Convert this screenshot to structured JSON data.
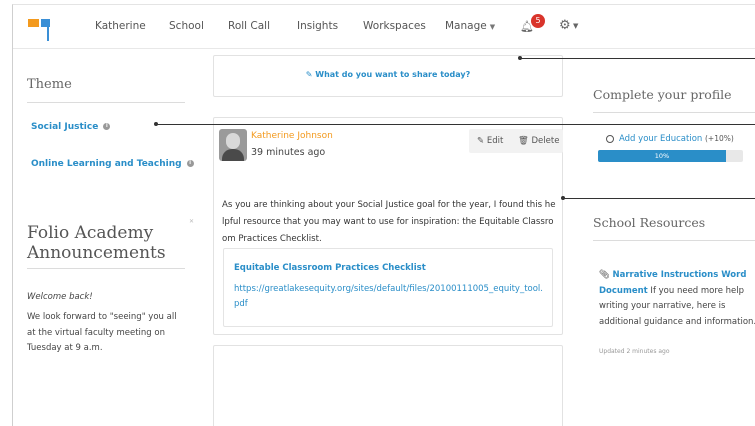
{
  "nav": {
    "items": [
      "Katherine",
      "School",
      "Roll Call",
      "Insights",
      "Workspaces",
      "Manage"
    ],
    "notification_count": "5",
    "bell_icon": "bell-icon",
    "settings_icon": "gear-icon"
  },
  "sidebar": {
    "theme_title": "Theme",
    "themes": [
      "Social Justice",
      "Online Learning and Teaching"
    ],
    "announcements": {
      "title": "Folio Academy Announcements",
      "greeting": "Welcome back!",
      "body": "We look forward to \"seeing\" you all at the virtual faculty meeting on Tuesday at 9 a.m."
    }
  },
  "feed": {
    "share_prompt": "What do you want to share today?",
    "post": {
      "author": "Katherine Johnson",
      "time": "39 minutes ago",
      "edit_label": "Edit",
      "delete_label": "Delete",
      "text": "As you are thinking about your Social Justice goal for the year, I found this helpful resource that you may want to use for inspiration: the Equitable Classroom Practices Checklist.",
      "link_title": "Equitable Classroom Practices Checklist",
      "link_url": "https://greatlakesequity.org/sites/default/files/20100111005_equity_tool.pdf"
    }
  },
  "profile": {
    "title": "Complete your profile",
    "item_label": "Add your Education",
    "item_bonus": "(+10%)",
    "progress_label": "10%",
    "progress_value": 0.88
  },
  "resources": {
    "title": "School Resources",
    "link_label": "Narrative Instructions Word Document",
    "body": " If you need more help writing your narrative, here is additional guidance and information.",
    "updated": "Updated 2 minutes ago"
  },
  "colors": {
    "accent": "#2a8ec8",
    "author": "#f39a1e",
    "badge": "#d9342b"
  }
}
